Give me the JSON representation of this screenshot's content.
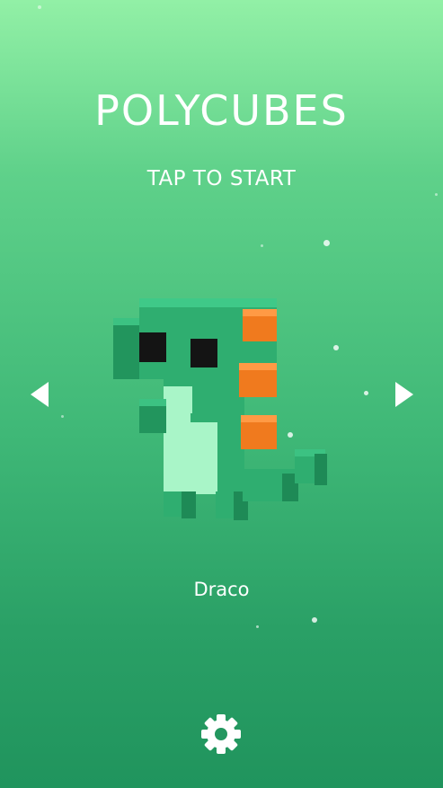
{
  "game": {
    "title": "POLYCUBES",
    "prompt": "TAP TO START"
  },
  "character": {
    "name": "Draco",
    "icon": "pixel-dinosaur-icon",
    "colors": {
      "body": "#2fae70",
      "body_dark": "#1e8a56",
      "belly": "#a9f5c8",
      "spikes": "#f07a1e",
      "eyes": "#141414"
    }
  },
  "navigation": {
    "previous_icon": "triangle-left-icon",
    "next_icon": "triangle-right-icon"
  },
  "settings": {
    "icon": "gear-icon"
  },
  "colors": {
    "background_top": "#92f0a6",
    "background_bottom": "#20945d",
    "text": "#ffffff"
  }
}
